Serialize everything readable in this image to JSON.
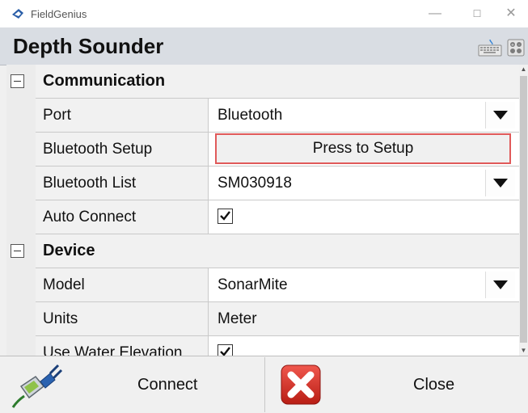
{
  "window": {
    "title": "FieldGenius",
    "min_glyph": "—",
    "max_glyph": "☐",
    "close_glyph": "✕"
  },
  "header": {
    "title": "Depth Sounder",
    "icons": [
      "keyboard-icon",
      "calculator-icon"
    ]
  },
  "sections": {
    "communication": {
      "title": "Communication",
      "port": {
        "label": "Port",
        "value": "Bluetooth"
      },
      "bluetooth_setup": {
        "label": "Bluetooth Setup",
        "button": "Press to Setup"
      },
      "bluetooth_list": {
        "label": "Bluetooth List",
        "value": "SM030918"
      },
      "auto_connect": {
        "label": "Auto Connect",
        "checked": true
      }
    },
    "device": {
      "title": "Device",
      "model": {
        "label": "Model",
        "value": "SonarMite"
      },
      "units": {
        "label": "Units",
        "value": "Meter"
      },
      "use_water_elevation": {
        "label": "Use Water Elevation",
        "checked": true
      }
    }
  },
  "footer": {
    "connect_label": "Connect",
    "close_label": "Close"
  },
  "colors": {
    "header_bg": "#d9dde3",
    "highlight_border": "#e05a5a",
    "close_icon_red": "#e02b20"
  }
}
